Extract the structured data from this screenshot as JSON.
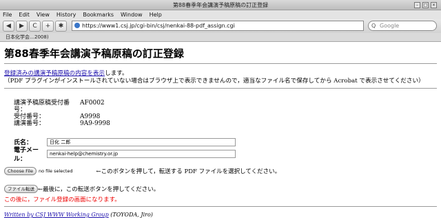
{
  "window": {
    "title": "第88春季年会講演予稿原稿の訂正登録"
  },
  "menu": [
    "File",
    "Edit",
    "View",
    "History",
    "Bookmarks",
    "Window",
    "Help"
  ],
  "nav": {
    "back": "◀",
    "forward": "▶",
    "reload": "C",
    "add": "+",
    "settings": "✱",
    "url": "https://www1.csj.jp/cgi-bin/csj/nenkai-88-pdf_assign.cgi",
    "search_placeholder": "Google"
  },
  "bookmarks": {
    "item": "日本化学会…2008)"
  },
  "page": {
    "heading": "第88春季年会講演予稿原稿の訂正登録",
    "view_link": "登録済みの講演予稿原稿の内容を表示",
    "view_suffix": "します。",
    "pdf_note": "（PDF プラグインがインストールされていない場合はブラウザ上で表示できませんので，適当なファイル名で保存してから Acrobat で表示させてください）",
    "info": [
      {
        "label": "講演予稿原稿受付番号：",
        "value": "AF0002"
      },
      {
        "label": "受付番号：",
        "value": "A9998"
      },
      {
        "label": "講演番号：",
        "value": "9A9-9998"
      }
    ],
    "name_label": "氏名：",
    "name_value": "日化 二郎",
    "email_label": "電子メール：",
    "email_value": "nenkai-help@chemistry.or.jp",
    "choose_file": "Choose File",
    "no_file": "no file selected",
    "file_instruction": "←このボタンを押して，転送する PDF ファイルを選択してください。",
    "submit_button": "ファイル転送",
    "submit_instruction": "←最後に，この転送ボタンを押してください。",
    "red_note": "この後に，ファイル登録の画面になります。",
    "footer_link": "Written by CSJ WWW Working Group",
    "footer_author": "(TOYODA, Jiro)"
  }
}
